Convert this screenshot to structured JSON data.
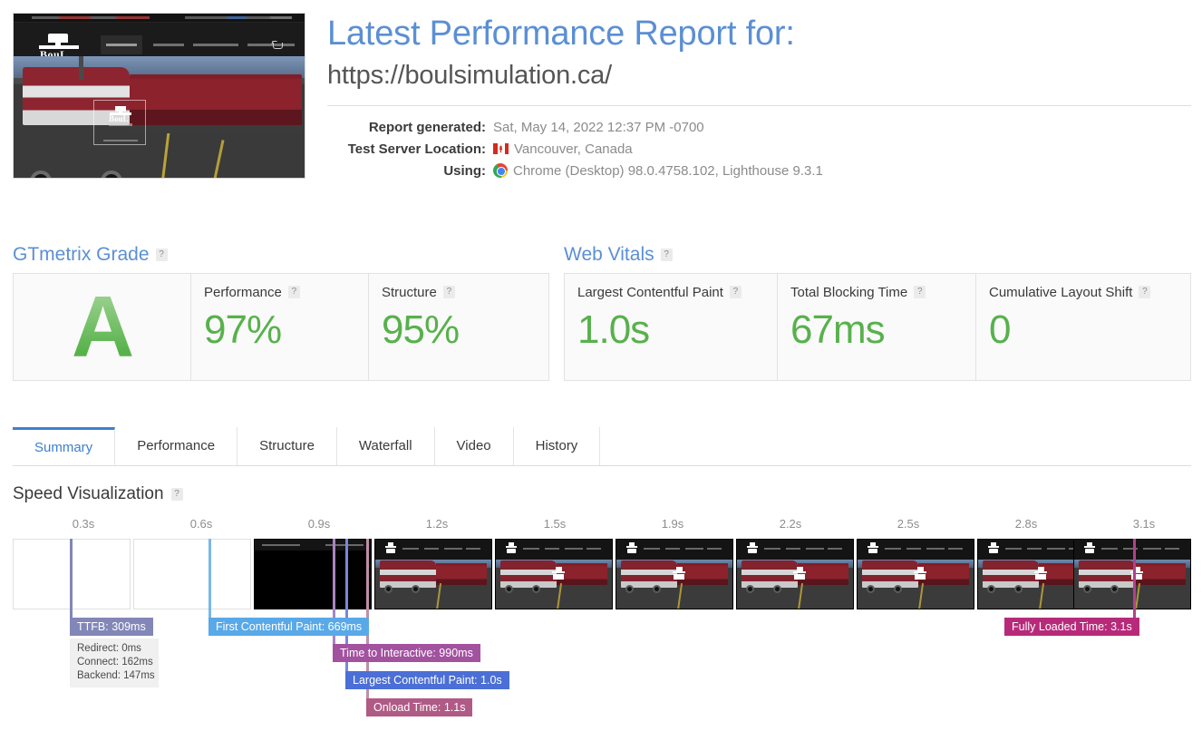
{
  "header": {
    "title": "Latest Performance Report for:",
    "url": "https://boulsimulation.ca/",
    "meta": [
      {
        "label": "Report generated:",
        "value": "Sat, May 14, 2022 12:37 PM -0700",
        "icon": ""
      },
      {
        "label": "Test Server Location:",
        "value": "Vancouver, Canada",
        "icon": "canada-flag-icon"
      },
      {
        "label": "Using:",
        "value": "Chrome (Desktop) 98.0.4758.102, Lighthouse 9.3.1",
        "icon": "chrome-icon"
      }
    ]
  },
  "gtmetrix_grade": {
    "heading": "GTmetrix Grade",
    "help": "?",
    "grade": "A",
    "cards": [
      {
        "label": "Performance",
        "help": "?",
        "value": "97%"
      },
      {
        "label": "Structure",
        "help": "?",
        "value": "95%"
      }
    ]
  },
  "web_vitals": {
    "heading": "Web Vitals",
    "help": "?",
    "cards": [
      {
        "label": "Largest Contentful Paint",
        "help": "?",
        "value": "1.0s"
      },
      {
        "label": "Total Blocking Time",
        "help": "?",
        "value": "67ms"
      },
      {
        "label": "Cumulative Layout Shift",
        "help": "?",
        "value": "0"
      }
    ]
  },
  "tabs": [
    {
      "label": "Summary",
      "active": true
    },
    {
      "label": "Performance",
      "active": false
    },
    {
      "label": "Structure",
      "active": false
    },
    {
      "label": "Waterfall",
      "active": false
    },
    {
      "label": "Video",
      "active": false
    },
    {
      "label": "History",
      "active": false
    }
  ],
  "speed_visualization": {
    "heading": "Speed Visualization",
    "help": "?",
    "ticks": [
      "0.3s",
      "0.6s",
      "0.9s",
      "1.2s",
      "1.5s",
      "1.9s",
      "2.2s",
      "2.5s",
      "2.8s",
      "3.1s"
    ],
    "markers": [
      {
        "name": "ttfb",
        "label": "TTFB: 309ms",
        "color": "#8287b8"
      },
      {
        "name": "first-contentful-paint",
        "label": "First Contentful Paint: 669ms",
        "color": "#59a9e8"
      },
      {
        "name": "time-to-interactive",
        "label": "Time to Interactive: 990ms",
        "color": "#a057ae"
      },
      {
        "name": "largest-contentful-paint",
        "label": "Largest Contentful Paint: 1.0s",
        "color": "#4b6fd6"
      },
      {
        "name": "onload-time",
        "label": "Onload Time: 1.1s",
        "color": "#b05a86"
      },
      {
        "name": "fully-loaded-time",
        "label": "Fully Loaded Time: 3.1s",
        "color": "#b72a7a"
      }
    ],
    "ttfb_breakdown": [
      "Redirect: 0ms",
      "Connect: 162ms",
      "Backend: 147ms"
    ]
  },
  "colors": {
    "brand_blue": "#5b8fd4",
    "score_green": "#58b14c",
    "tab_active": "#3e7fd0"
  }
}
